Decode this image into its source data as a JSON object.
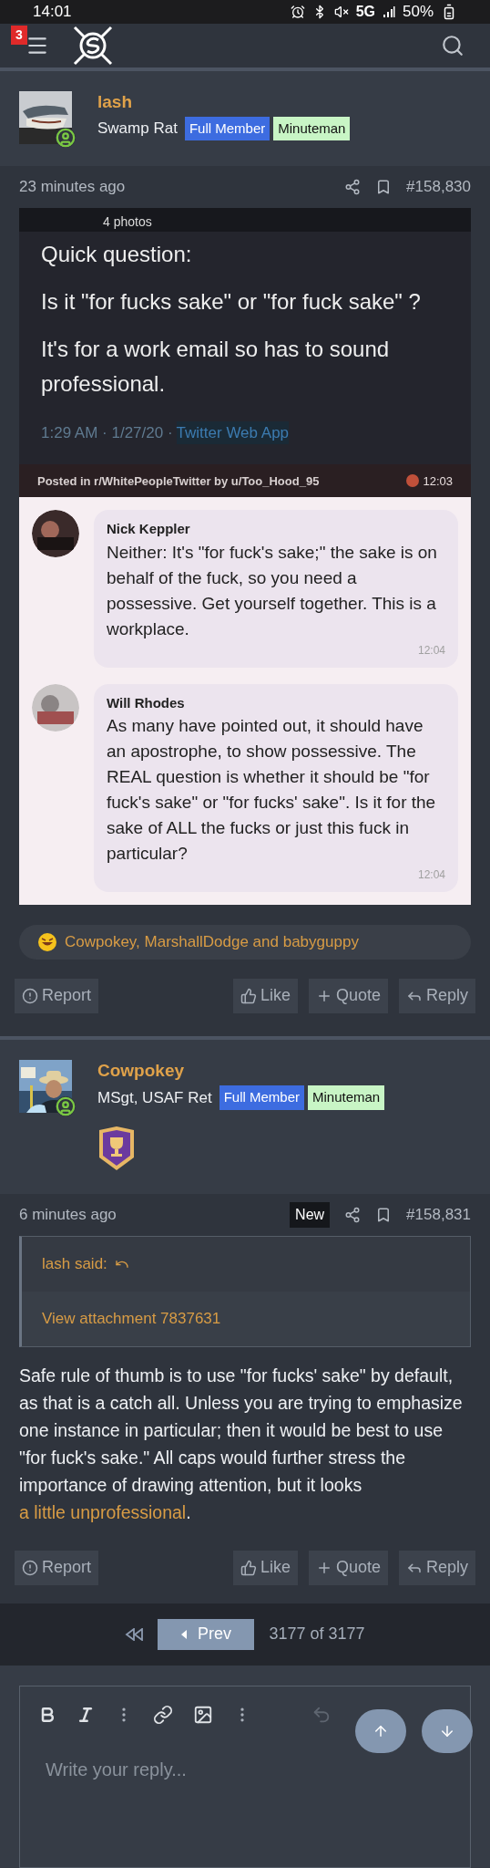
{
  "status_bar": {
    "time": "14:01",
    "network": "5G",
    "battery": "50%"
  },
  "header": {
    "notification_count": "3"
  },
  "posts": [
    {
      "author": "lash",
      "user_title": "Swamp Rat",
      "badges": [
        {
          "label": "Full Member",
          "color": "#3d6ce0"
        },
        {
          "label": "Minuteman",
          "color": "#c8f5c5"
        }
      ],
      "trophy": false,
      "time": "23 minutes ago",
      "is_new": false,
      "number": "#158,830",
      "attachment": {
        "photos_label": "4 photos",
        "tweet_lines": [
          "Quick question:",
          "Is it \"for fucks sake\" or \"for fuck sake\" ?",
          "It's for a work email so has to sound professional."
        ],
        "tweet_meta": "1:29 AM · 1/27/20 ·",
        "tweet_source": "Twitter Web App",
        "caption": "Posted in r/WhitePeopleTwitter by u/Too_Hood_95",
        "caption_time": "12:03",
        "comments": [
          {
            "name": "Nick Keppler",
            "text": "Neither: It's \"for fuck's sake;\" the sake is on behalf of the fuck, so you need a possessive. Get yourself together. This is a workplace.",
            "time": "12:04"
          },
          {
            "name": "Will Rhodes",
            "text": "As many have pointed out, it should have an apostrophe, to show possessive. The REAL question is whether it should be \"for fuck's sake\" or \"for fucks' sake\". Is it for the sake of ALL the fucks or just this fuck in particular?",
            "time": "12:04"
          }
        ]
      },
      "reactions": "Cowpokey, MarshallDodge and babyguppy",
      "actions": [
        {
          "kind": "report",
          "label": "Report"
        },
        {
          "kind": "like",
          "label": "Like"
        },
        {
          "kind": "quote",
          "label": "Quote"
        },
        {
          "kind": "reply",
          "label": "Reply"
        }
      ]
    },
    {
      "author": "Cowpokey",
      "user_title": "MSgt, USAF Ret",
      "badges": [
        {
          "label": "Full Member",
          "color": "#3d6ce0"
        },
        {
          "label": "Minuteman",
          "color": "#c8f5c5"
        }
      ],
      "trophy": true,
      "time": "6 minutes ago",
      "is_new": true,
      "new_label": "New",
      "number": "#158,831",
      "quote": {
        "said": "lash said:",
        "link": "View attachment 7837631"
      },
      "body": {
        "before": "Safe rule of thumb is to use \"for fucks' sake\" by default, as that is a catch all. Unless you are trying to emphasize one instance in particular; then it would be best to use \"for fuck's sake.\" All caps would further stress the importance of drawing attention, but it looks ",
        "link": "a little unprofessional",
        "after": "."
      },
      "actions": [
        {
          "kind": "report",
          "label": "Report"
        },
        {
          "kind": "like",
          "label": "Like"
        },
        {
          "kind": "quote",
          "label": "Quote"
        },
        {
          "kind": "reply",
          "label": "Reply"
        }
      ]
    }
  ],
  "pagination": {
    "prev": "Prev",
    "page_info": "3177 of 3177"
  },
  "editor": {
    "placeholder": "Write your reply..."
  }
}
